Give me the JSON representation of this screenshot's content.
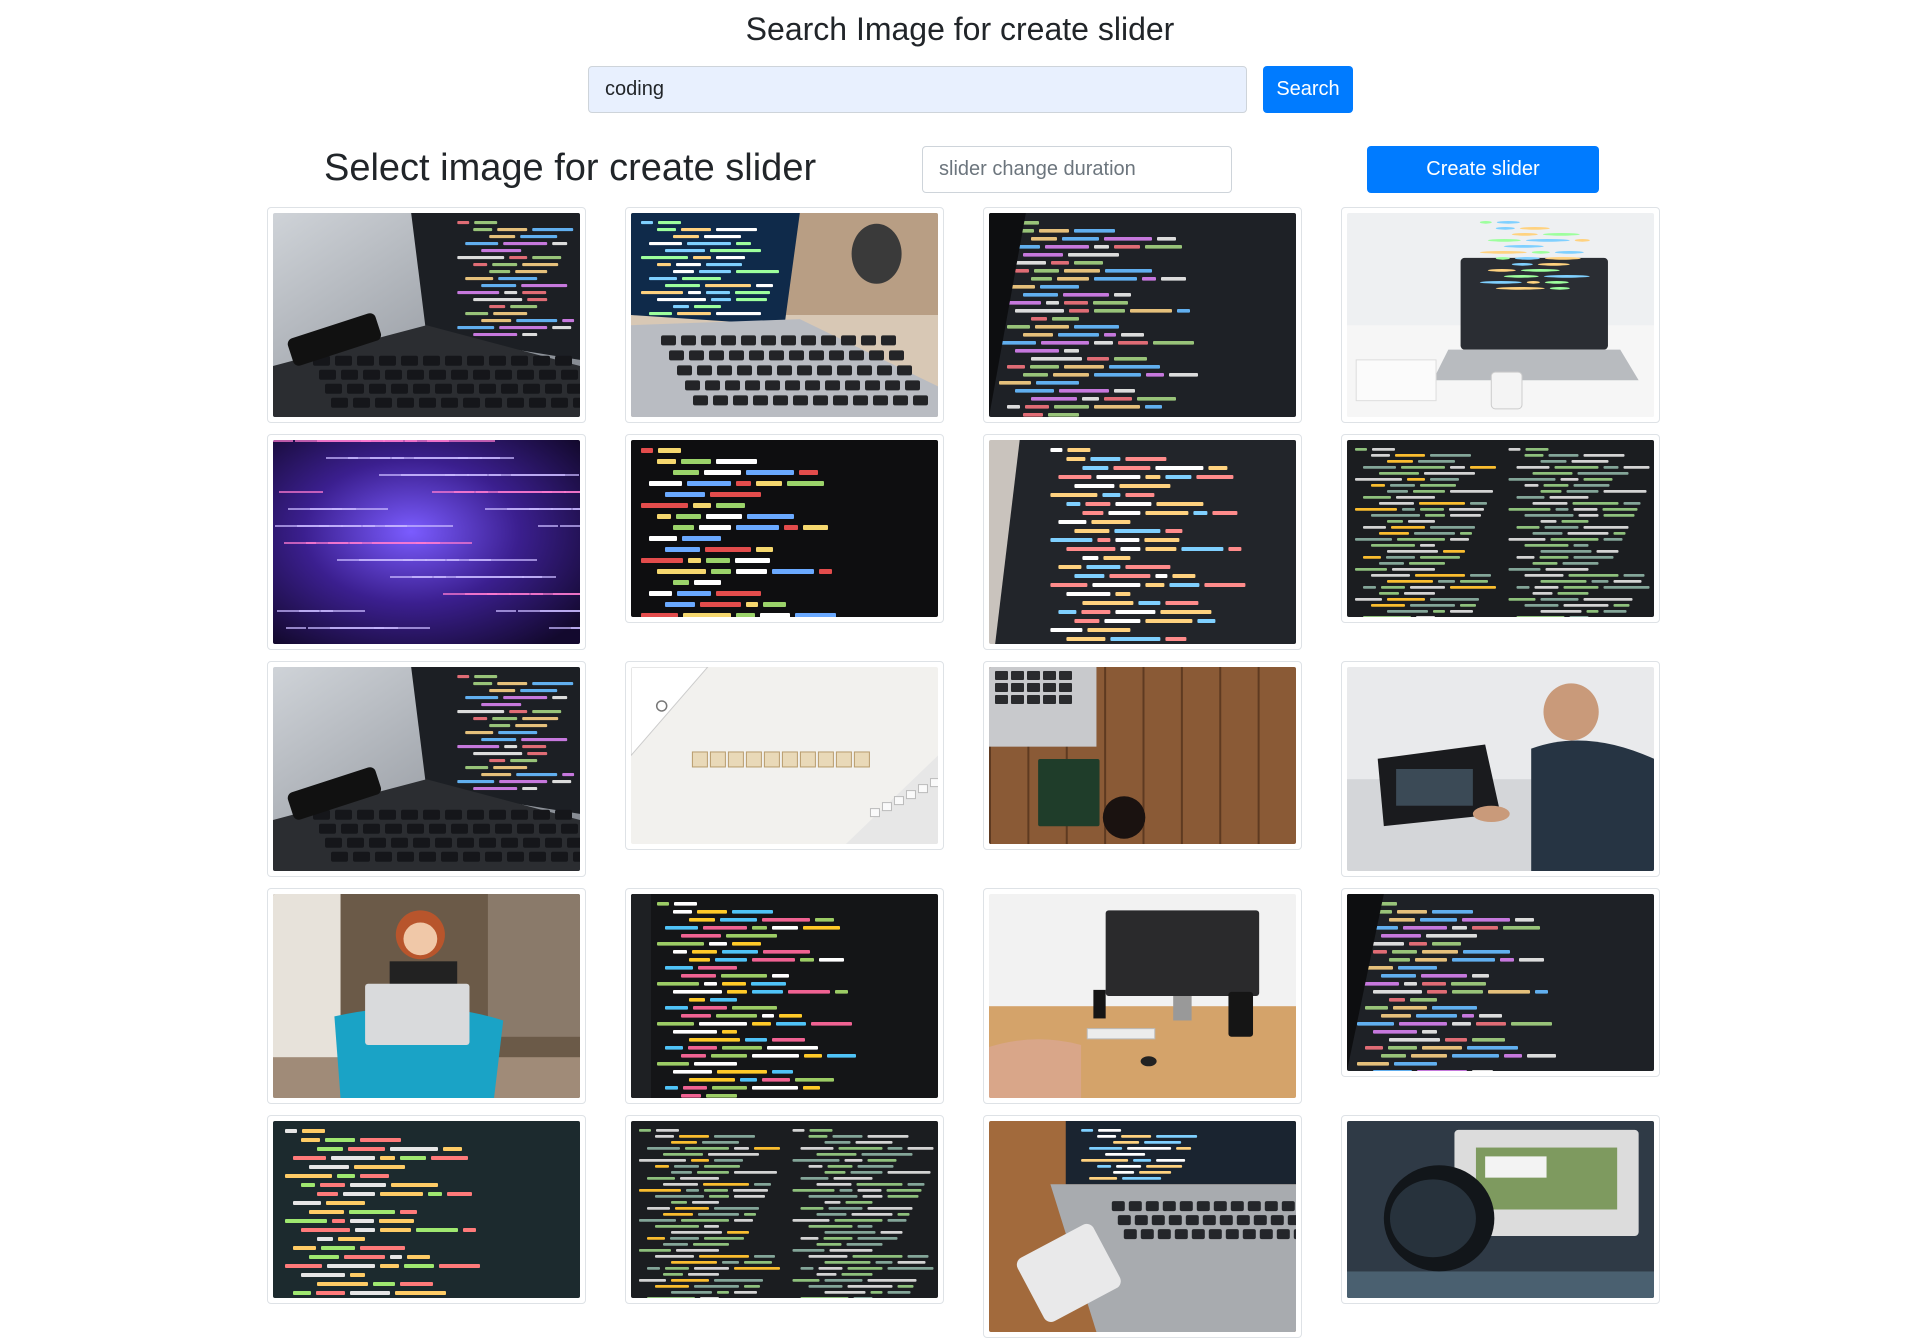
{
  "header": {
    "title": "Search Image for create slider"
  },
  "search": {
    "value": "coding",
    "button_label": "Search"
  },
  "slider_panel": {
    "title": "Select image for create slider",
    "duration_placeholder": "slider change duration",
    "create_label": "Create slider"
  },
  "thumbnails": [
    {
      "theme": "laptop-code-grey"
    },
    {
      "theme": "laptop-table-mug"
    },
    {
      "theme": "code-screen-dark"
    },
    {
      "theme": "laptop-white-desk"
    },
    {
      "theme": "code-purple-blur"
    },
    {
      "theme": "html-code-screen"
    },
    {
      "theme": "code-screen-angle"
    },
    {
      "theme": "editor-dark-columns"
    },
    {
      "theme": "laptop-code-grey"
    },
    {
      "theme": "programmer-tiles"
    },
    {
      "theme": "wood-desk-laptop"
    },
    {
      "theme": "man-on-laptop"
    },
    {
      "theme": "woman-laptop-chair"
    },
    {
      "theme": "html-code-lines"
    },
    {
      "theme": "monitor-desk"
    },
    {
      "theme": "code-screen-dark"
    },
    {
      "theme": "code-screen-teal"
    },
    {
      "theme": "editor-dark-columns"
    },
    {
      "theme": "laptop-phone-wood"
    },
    {
      "theme": "person-headphones-monitor"
    }
  ]
}
